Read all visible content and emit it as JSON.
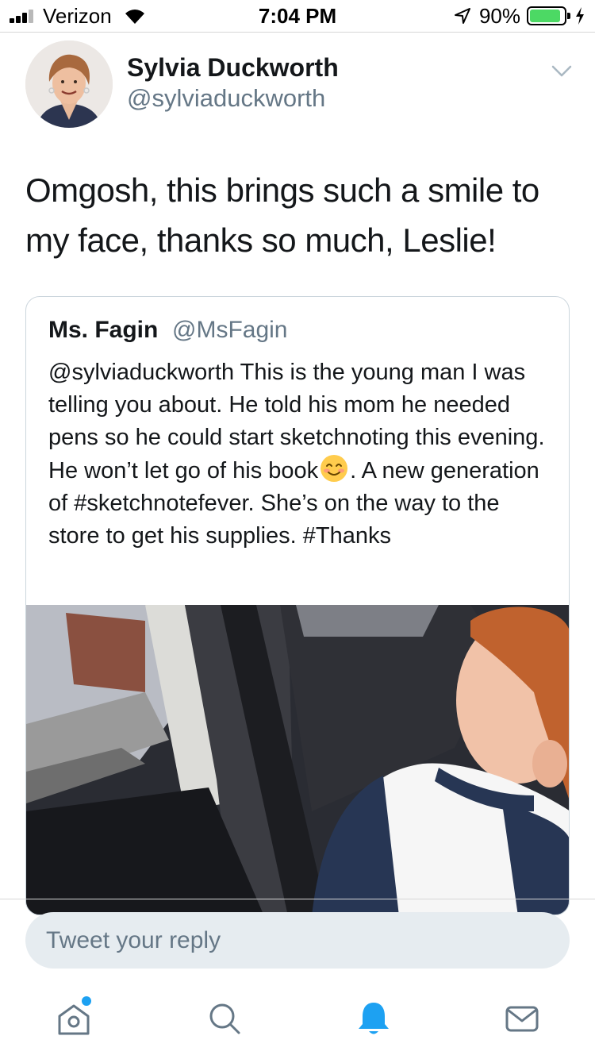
{
  "status_bar": {
    "carrier": "Verizon",
    "time": "7:04 PM",
    "battery_percent": "90%",
    "battery_level": 0.9,
    "signal_bars_active": 3,
    "signal_bars_total": 4
  },
  "tweet": {
    "author_name": "Sylvia Duckworth",
    "author_handle": "@sylviaduckworth",
    "text": "Omgosh, this brings such a smile to my face, thanks so much, Leslie!"
  },
  "quoted_tweet": {
    "author_name": "Ms. Fagin",
    "author_handle": "@MsFagin",
    "text_before_emoji": "@sylviaduckworth This is the young man I was telling you about. He told his mom he needed pens so he could start sketchnoting this evening. He won’t let go of his book",
    "emoji": "smiling-face-emoji",
    "text_after_emoji": ". A new generation of #sketchnotefever. She’s on the way to the store to get his supplies. #Thanks"
  },
  "reply": {
    "placeholder": "Tweet your reply"
  },
  "tab_bar": {
    "tabs": [
      {
        "icon": "home-icon",
        "active": false,
        "has_notification_dot": true
      },
      {
        "icon": "search-icon",
        "active": false,
        "has_notification_dot": false
      },
      {
        "icon": "bell-icon",
        "active": true,
        "has_notification_dot": false
      },
      {
        "icon": "mail-icon",
        "active": false,
        "has_notification_dot": false
      }
    ]
  },
  "colors": {
    "accent": "#1da1f2",
    "secondary_text": "#657786",
    "border": "#ccd6dd",
    "reply_background": "#e6ecf0",
    "battery": "#4cd964"
  }
}
